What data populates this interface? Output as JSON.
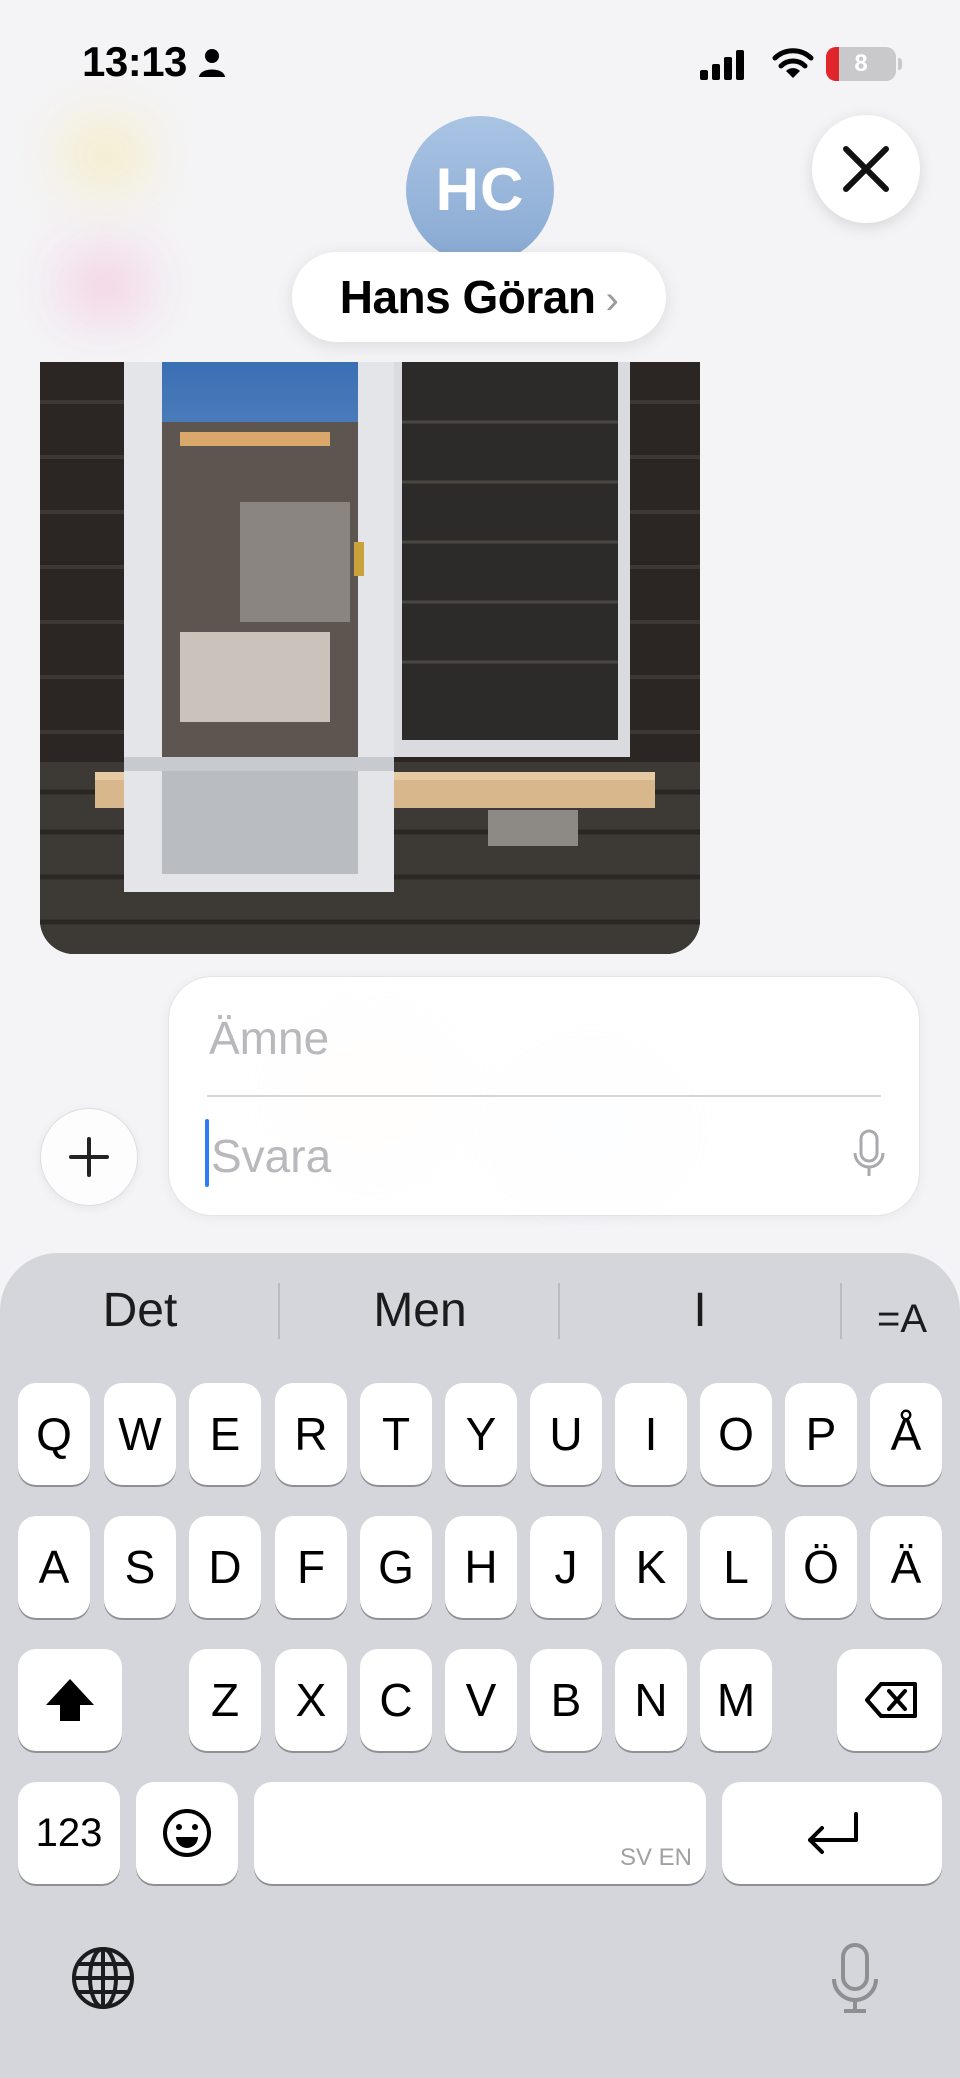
{
  "status_bar": {
    "time": "13:13",
    "battery": "8"
  },
  "header": {
    "avatar_initials": "HC",
    "contact_name": "Hans Göran",
    "chevron": "›"
  },
  "compose": {
    "subject_placeholder": "Ämne",
    "reply_placeholder": "Svara"
  },
  "keyboard": {
    "suggestions": [
      "Det",
      "Men",
      "I"
    ],
    "format_icon": "=A",
    "rows": [
      [
        "Q",
        "W",
        "E",
        "R",
        "T",
        "Y",
        "U",
        "I",
        "O",
        "P",
        "Å"
      ],
      [
        "A",
        "S",
        "D",
        "F",
        "G",
        "H",
        "J",
        "K",
        "L",
        "Ö",
        "Ä"
      ],
      [
        "Z",
        "X",
        "C",
        "V",
        "B",
        "N",
        "M"
      ]
    ],
    "numbers_label": "123",
    "space_language_hint": "SV EN"
  },
  "colors": {
    "avatar": "#99b6dc",
    "cursor": "#2f7bf6",
    "battery_low": "#e0252b",
    "keyboard_bg": "#d4d6dc"
  },
  "icons": [
    "person-icon",
    "signal-icon",
    "wifi-icon",
    "battery-icon",
    "close-icon",
    "chevron-right-icon",
    "plus-icon",
    "microphone-icon",
    "shift-icon",
    "backspace-icon",
    "emoji-icon",
    "return-icon",
    "globe-icon",
    "text-format-icon"
  ]
}
